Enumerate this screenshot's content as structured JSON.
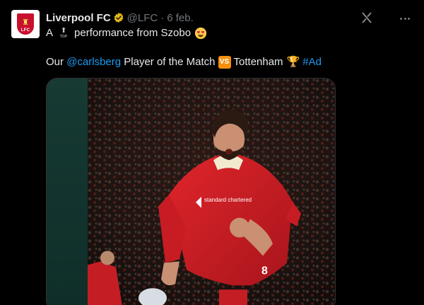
{
  "tweet": {
    "author_name": "Liverpool FC",
    "handle": "@LFC",
    "separator": "·",
    "date": "6 feb.",
    "avatar_text": "LFC",
    "text_line1": {
      "before": "A",
      "top_icon_label": "TOP",
      "after": "performance from Szobo"
    },
    "text_line2": {
      "prefix": "Our",
      "mention": "@carlsberg",
      "middle": "Player of the Match",
      "vs_label": "VS",
      "opponent": "Tottenham",
      "hashtag": "#Ad"
    }
  },
  "media": {
    "kit_sponsor": "standard chartered",
    "shirt_number": "8"
  },
  "colors": {
    "background": "#000000",
    "link": "#1d9bf0",
    "verified": "#e2b719",
    "liverpool_red": "#c8102e"
  },
  "icons": {
    "verified": "gold-verified-badge-icon",
    "grok": "grok-icon",
    "more": "more-dots-icon",
    "emoji_top": "top-arrow-emoji",
    "emoji_heart_eyes": "heart-eyes-emoji",
    "emoji_vs": "vs-button-emoji",
    "emoji_trophy": "trophy-emoji"
  }
}
